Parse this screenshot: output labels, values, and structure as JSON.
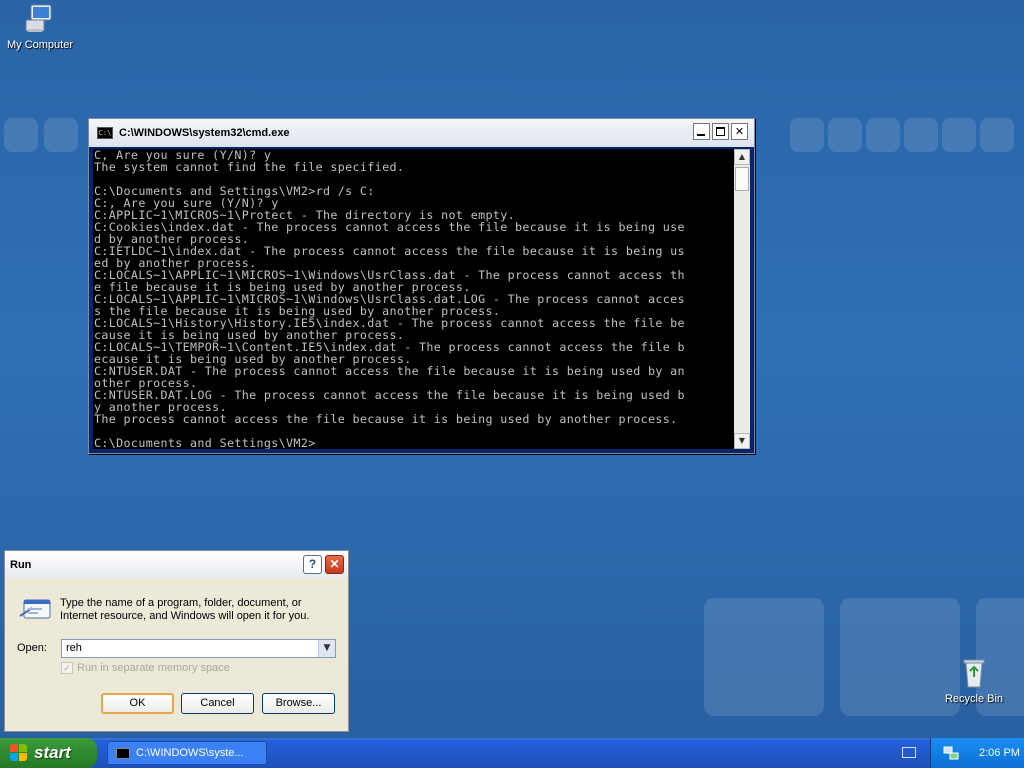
{
  "desktop": {
    "icons": [
      {
        "label": "My Computer"
      },
      {
        "label": "Recycle Bin"
      }
    ]
  },
  "cmd_window": {
    "title": "C:\\WINDOWS\\system32\\cmd.exe",
    "lines": [
      "C, Are you sure (Y/N)? y",
      "The system cannot find the file specified.",
      "",
      "C:\\Documents and Settings\\VM2>rd /s C:",
      "C:, Are you sure (Y/N)? y",
      "C:APPLIC~1\\MICROS~1\\Protect - The directory is not empty.",
      "C:Cookies\\index.dat - The process cannot access the file because it is being use",
      "d by another process.",
      "C:IETLDC~1\\index.dat - The process cannot access the file because it is being us",
      "ed by another process.",
      "C:LOCALS~1\\APPLIC~1\\MICROS~1\\Windows\\UsrClass.dat - The process cannot access th",
      "e file because it is being used by another process.",
      "C:LOCALS~1\\APPLIC~1\\MICROS~1\\Windows\\UsrClass.dat.LOG - The process cannot acces",
      "s the file because it is being used by another process.",
      "C:LOCALS~1\\History\\History.IE5\\index.dat - The process cannot access the file be",
      "cause it is being used by another process.",
      "C:LOCALS~1\\TEMPOR~1\\Content.IE5\\index.dat - The process cannot access the file b",
      "ecause it is being used by another process.",
      "C:NTUSER.DAT - The process cannot access the file because it is being used by an",
      "other process.",
      "C:NTUSER.DAT.LOG - The process cannot access the file because it is being used b",
      "y another process.",
      "The process cannot access the file because it is being used by another process.",
      "",
      "C:\\Documents and Settings\\VM2>"
    ]
  },
  "run_dialog": {
    "title": "Run",
    "description": "Type the name of a program, folder, document, or Internet resource, and Windows will open it for you.",
    "open_label": "Open:",
    "open_value": "reh",
    "separate_memory_label": "Run in separate memory space",
    "ok_label": "OK",
    "cancel_label": "Cancel",
    "browse_label": "Browse..."
  },
  "taskbar": {
    "start_label": "start",
    "task_label": "C:\\WINDOWS\\syste...",
    "clock": "2:06 PM"
  },
  "colors": {
    "desktop_blue": "#2f70b6",
    "taskbar_blue": "#225acd",
    "start_green": "#2f8a2f",
    "console_text": "#c0c0c0"
  }
}
